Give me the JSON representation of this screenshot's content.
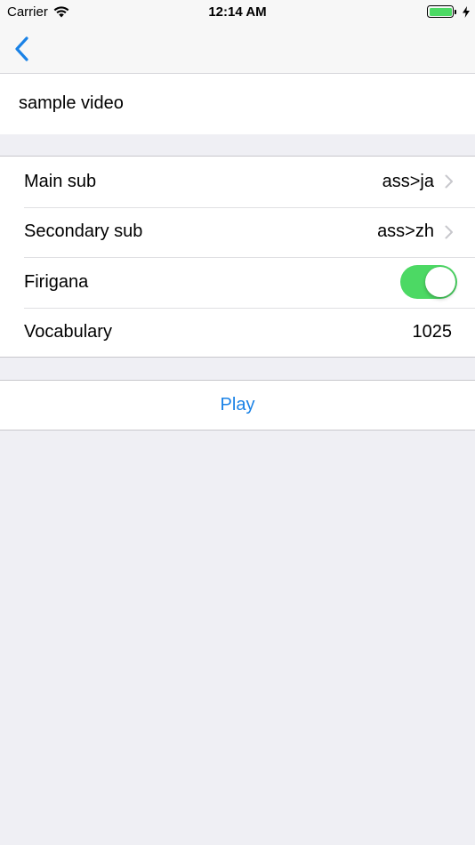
{
  "status_bar": {
    "carrier": "Carrier",
    "time": "12:14 AM",
    "battery_level": 1.0,
    "charging": true
  },
  "nav": {
    "back_icon": "chevron-left-icon"
  },
  "video": {
    "title": "sample video"
  },
  "settings": {
    "main_sub": {
      "label": "Main sub",
      "value": "ass>ja"
    },
    "secondary_sub": {
      "label": "Secondary sub",
      "value": "ass>zh"
    },
    "furigana": {
      "label": "Firigana",
      "enabled": true
    },
    "vocabulary": {
      "label": "Vocabulary",
      "value": "1025"
    }
  },
  "actions": {
    "play_label": "Play"
  },
  "colors": {
    "accent": "#1a82e6",
    "toggle_on": "#4cd964",
    "background": "#efeff4"
  }
}
